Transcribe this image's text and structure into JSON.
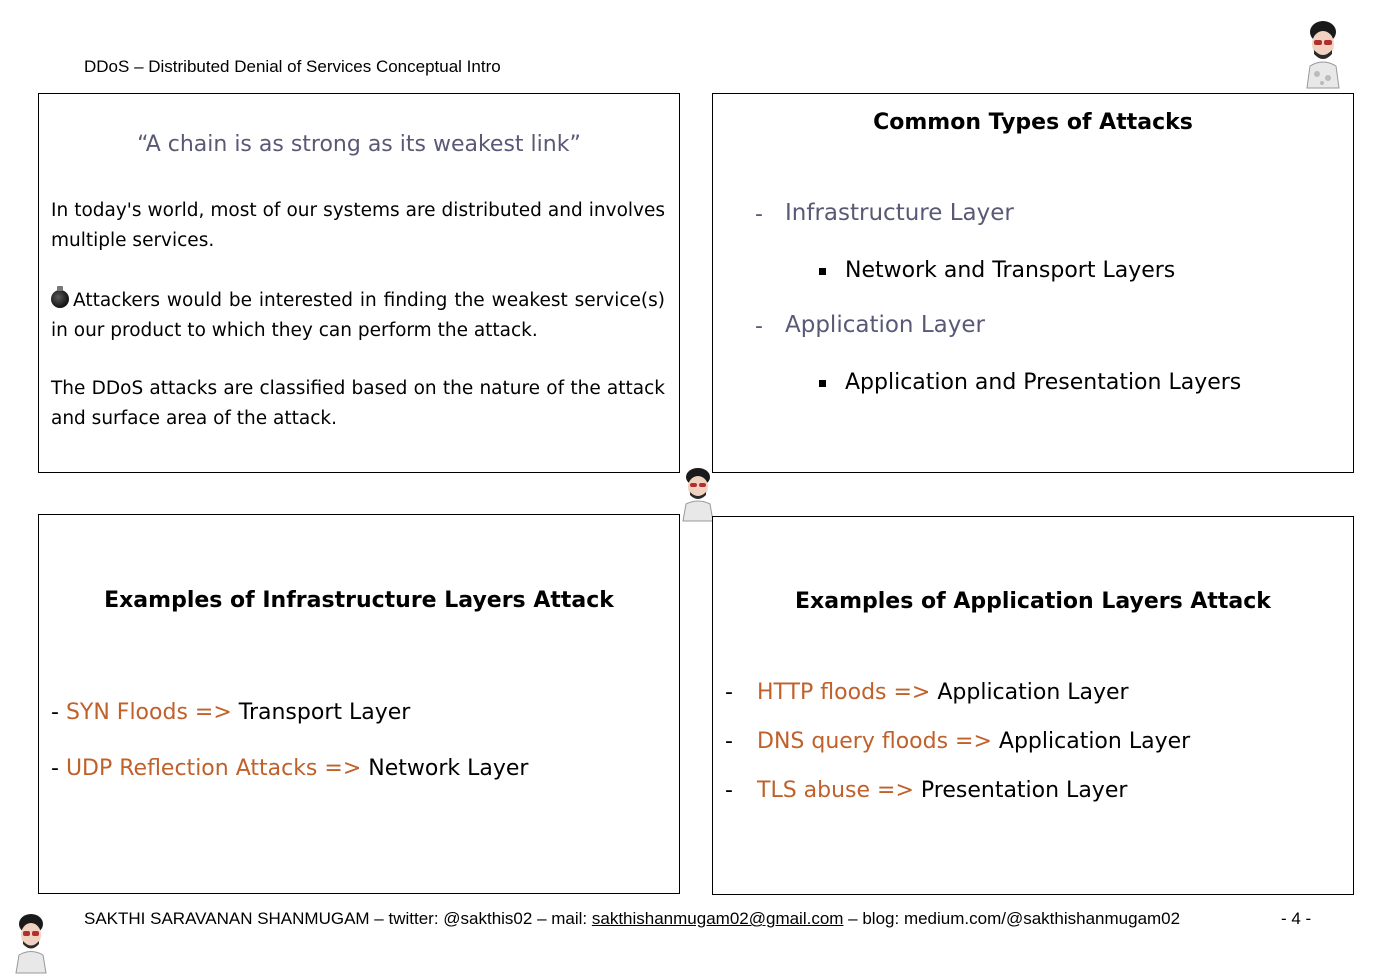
{
  "header": {
    "title": "DDoS – Distributed Denial of Services Conceptual Intro"
  },
  "intro_box": {
    "quote": "“A chain is as strong as its weakest link”",
    "paragraph1": "In today's world, most of our systems are distributed and involves multiple services.",
    "paragraph2": "Attackers would be interested in finding the weakest service(s) in our product to which they can perform the attack.",
    "paragraph3": "The DDoS attacks are classified based on the nature of the attack and surface area of the attack."
  },
  "types_box": {
    "title": "Common Types of Attacks",
    "items": [
      {
        "dash": "-",
        "label": "Infrastructure Layer",
        "sub": "Network and Transport Layers"
      },
      {
        "dash": "-",
        "label": "Application Layer",
        "sub": "Application and Presentation Layers"
      }
    ]
  },
  "infra_box": {
    "title": "Examples of Infrastructure Layers Attack",
    "items": [
      {
        "dash": "- ",
        "attack": "SYN Floods =>",
        "layer": " Transport Layer"
      },
      {
        "dash": "- ",
        "attack": "UDP Reflection Attacks =>",
        "layer": " Network Layer"
      }
    ]
  },
  "app_box": {
    "title": "Examples of Application Layers Attack",
    "items": [
      {
        "dash": "-",
        "attack": "HTTP floods =>",
        "layer": " Application Layer"
      },
      {
        "dash": "-",
        "attack": "DNS query floods =>",
        "layer": " Application Layer"
      },
      {
        "dash": "-",
        "attack": "TLS abuse =>",
        "layer": " Presentation Layer"
      }
    ]
  },
  "footer": {
    "author": "SAKTHI SARAVANAN SHANMUGAM – twitter: @sakthis02 – mail: ",
    "email": "sakthishanmugam02@gmail.com",
    "blog": " – blog: medium.com/@sakthishanmugam02",
    "page": "- 4 -"
  },
  "colors": {
    "accent_gray": "#595976",
    "accent_orange": "#c0602a"
  }
}
